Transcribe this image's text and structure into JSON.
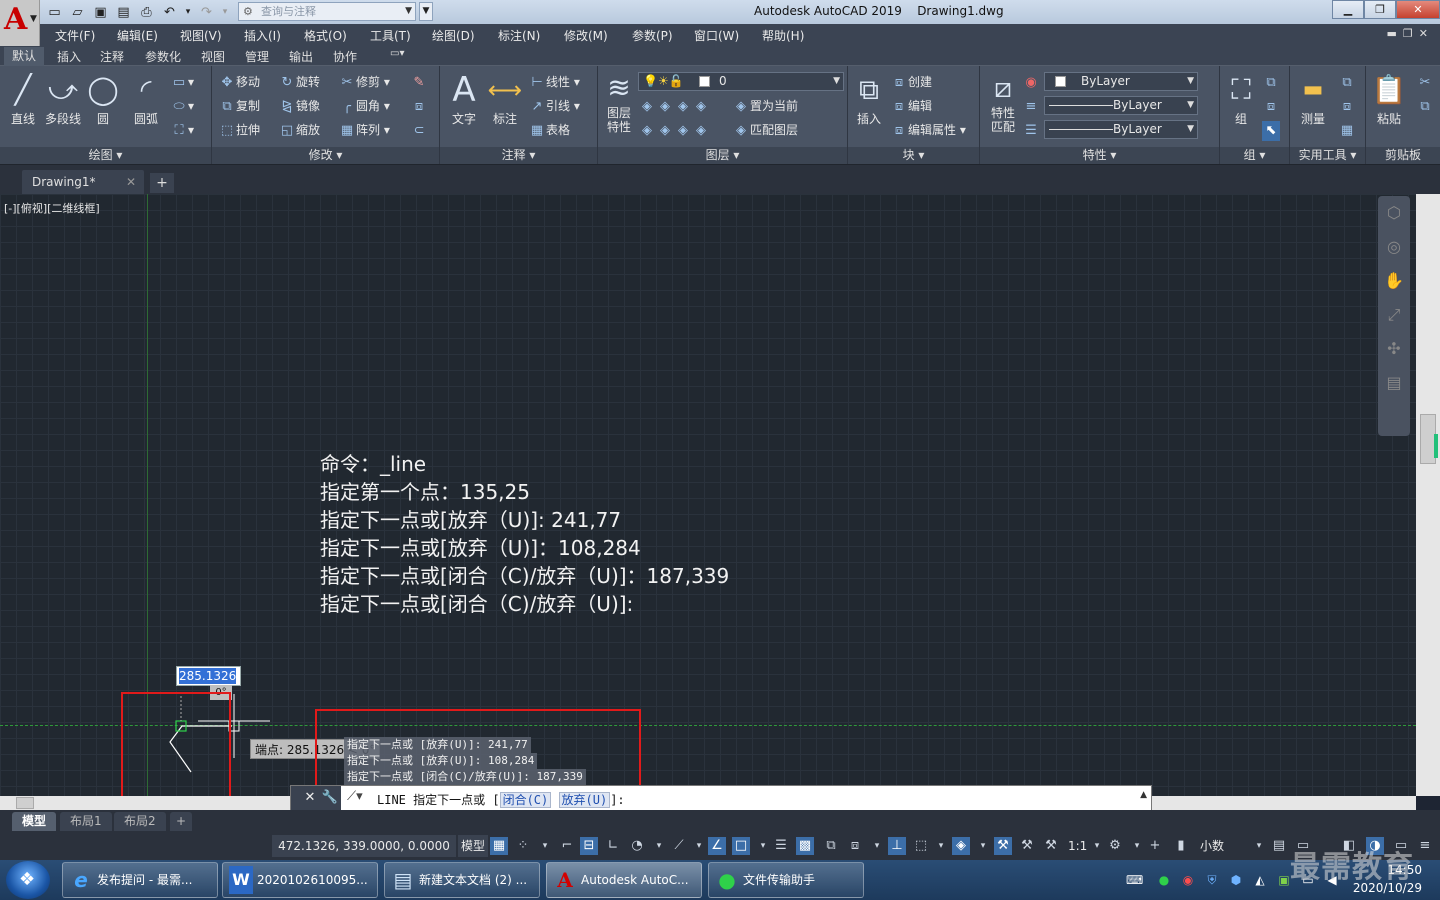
{
  "title_bar": {
    "app_title": "Autodesk AutoCAD 2019",
    "doc_title": "Drawing1.dwg",
    "search_placeholder": "查询与注释"
  },
  "menu": [
    "文件(F)",
    "编辑(E)",
    "视图(V)",
    "插入(I)",
    "格式(O)",
    "工具(T)",
    "绘图(D)",
    "标注(N)",
    "修改(M)",
    "参数(P)",
    "窗口(W)",
    "帮助(H)"
  ],
  "ribbon_tabs": [
    "默认",
    "插入",
    "注释",
    "参数化",
    "视图",
    "管理",
    "输出",
    "协作"
  ],
  "ribbon": {
    "draw": {
      "title": "绘图",
      "line": "直线",
      "polyline": "多段线",
      "circle": "圆",
      "arc": "圆弧"
    },
    "modify": {
      "title": "修改",
      "move": "移动",
      "rotate": "旋转",
      "trim": "修剪",
      "copy": "复制",
      "mirror": "镜像",
      "fillet": "圆角",
      "stretch": "拉伸",
      "scale": "缩放",
      "array": "阵列"
    },
    "annotation": {
      "title": "注释",
      "text": "文字",
      "dimension": "标注",
      "linear": "线性",
      "leader": "引线",
      "table": "表格"
    },
    "layers": {
      "title": "图层",
      "layer_props_1": "图层",
      "layer_props_2": "特性",
      "current_layer": "0",
      "set_current": "置为当前",
      "match_layer": "匹配图层"
    },
    "block": {
      "title": "块",
      "insert": "插入",
      "create": "创建",
      "edit": "编辑",
      "edit_attr": "编辑属性"
    },
    "properties": {
      "title": "特性",
      "match_1": "特性",
      "match_2": "匹配",
      "color": "ByLayer",
      "linetype": "ByLayer",
      "lineweight": "ByLayer"
    },
    "groups": {
      "title": "组",
      "group": "组"
    },
    "utilities": {
      "title": "实用工具",
      "measure": "测量"
    },
    "clipboard": {
      "title": "剪贴板",
      "paste": "粘贴"
    }
  },
  "file_tab": "Drawing1*",
  "viewport_label": "[-][俯视][二维线框]",
  "command_echo": [
    "命令：_line",
    "指定第一个点：135,25",
    "指定下一点或[放弃（U)]: 241,77",
    "指定下一点或[放弃（U)]：108,284",
    "指定下一点或[闭合（C)/放弃（U)]：187,339",
    "指定下一点或[闭合（C)/放弃（U)]:"
  ],
  "dynamic_input": {
    "value": "285.1326",
    "angle": "0°",
    "tooltip": "端点: 285.1326 < 0°"
  },
  "command_history": [
    "指定下一点或 [放弃(U)]: 241,77",
    "指定下一点或 [放弃(U)]: 108,284",
    "指定下一点或 [闭合(C)/放弃(U)]: 187,339"
  ],
  "command_line": {
    "prefix": "LINE 指定下一点或 [",
    "opt1": "闭合(C)",
    "opt2": "放弃(U)",
    "suffix": "]:"
  },
  "layout_tabs": [
    "模型",
    "布局1",
    "布局2"
  ],
  "status_bar": {
    "coords": "472.1326, 339.0000, 0.0000",
    "model": "模型",
    "scale": "1:1",
    "units": "小数"
  },
  "taskbar": {
    "tasks": [
      "发布提问 - 最需...",
      "2020102610095...",
      "新建文本文档 (2) ...",
      "Autodesk AutoC...",
      "文件传输助手"
    ],
    "time": "14:50",
    "date": "2020/10/29"
  },
  "watermark": "最需教育"
}
